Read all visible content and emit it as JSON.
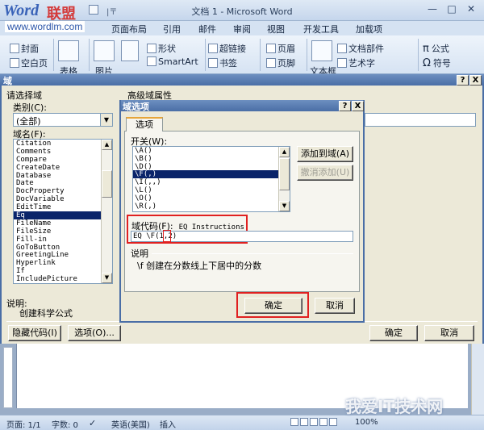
{
  "word": {
    "logo_word": "Word",
    "logo_cn": "联盟",
    "logo_url": "www.wordlm.com",
    "qa_sep": "|〒",
    "title": "文档 1 - Microsoft Word",
    "tabs": [
      "页面布局",
      "引用",
      "邮件",
      "审阅",
      "视图",
      "开发工具",
      "加载项"
    ],
    "ribbon": {
      "cover": "封面",
      "blank": "空白页",
      "table_partial": "表格",
      "picture_partial": "图片",
      "shapes": "形状",
      "smartart": "SmartArt",
      "hyperlink": "超链接",
      "bookmark": "书签",
      "header": "页眉",
      "footer": "页脚",
      "textbox_partial": "文本框",
      "quickparts": "文档部件",
      "wordart": "艺术字",
      "equation": "公式",
      "symbol": "符号",
      "pi": "π",
      "omega": "Ω"
    }
  },
  "field_dialog": {
    "title": "域",
    "help": "?",
    "close": "X",
    "choose_field": "请选择域",
    "category_label": "类别(C):",
    "category_value": "(全部)",
    "fieldname_label": "域名(F):",
    "field_names": [
      "Citation",
      "Comments",
      "Compare",
      "CreateDate",
      "Database",
      "Date",
      "DocProperty",
      "DocVariable",
      "EditTime",
      "Eq",
      "FileName",
      "FileSize",
      "Fill-in",
      "GoToButton",
      "GreetingLine",
      "Hyperlink",
      "If",
      "IncludePicture"
    ],
    "selected_field": "Eq",
    "advanced_label": "高级域属性",
    "desc_label": "说明:",
    "desc_text": "创建科学公式",
    "hide_codes": "隐藏代码(I)",
    "options": "选项(O)...",
    "ok": "确定",
    "cancel": "取消"
  },
  "options_dialog": {
    "title": "域选项",
    "help": "?",
    "close": "X",
    "tab": "选项",
    "switches_label": "开关(W):",
    "switches": [
      "\\A()",
      "\\B()",
      "\\D()",
      "\\F(,)",
      "\\I(,,)",
      "\\L()",
      "\\O()",
      "\\R(,)"
    ],
    "selected_switch": "\\F(,)",
    "add": "添加到域(A)",
    "undo_add": "撤消添加(U)",
    "code_label": "域代码(F):",
    "code_hint": "EQ Instructions",
    "code_value": "EQ \\F(1,2)",
    "desc_label": "说明",
    "desc_text": "\\f 创建在分数线上下居中的分数",
    "ok": "确定",
    "cancel": "取消"
  },
  "status": {
    "page": "页面: 1/1",
    "words": "字数: 0",
    "language": "英语(美国)",
    "insert": "插入",
    "zoom": "100%",
    "watermark": "我爱IT技术网"
  }
}
